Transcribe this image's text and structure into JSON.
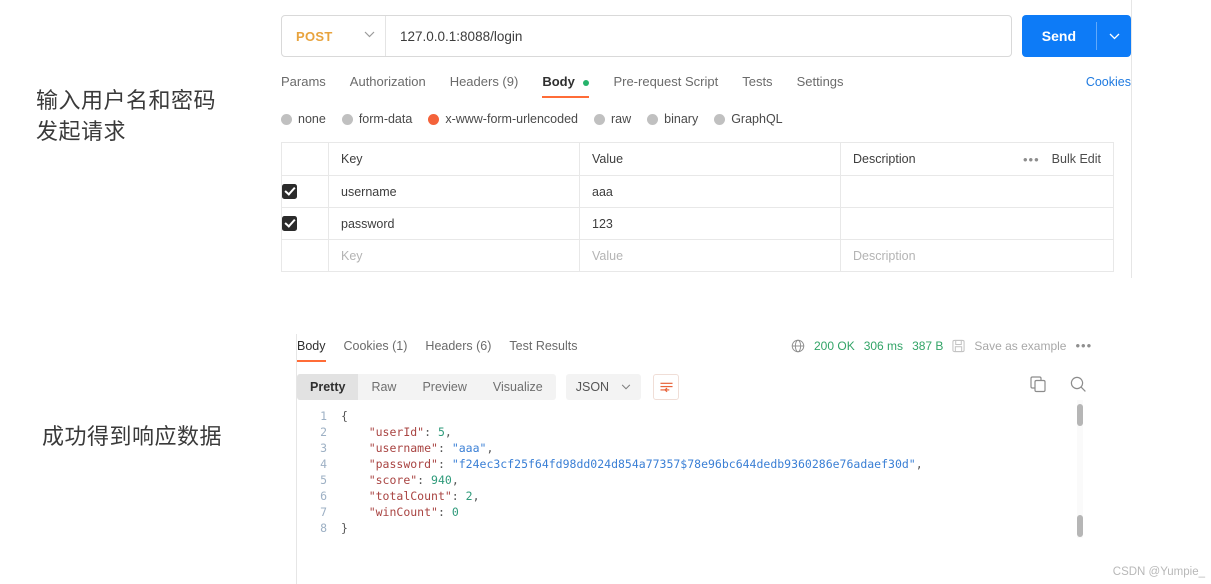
{
  "annotations": {
    "request_note": "输入用户名和密码\n发起请求",
    "response_note": "成功得到响应数据"
  },
  "request": {
    "method": "POST",
    "method_caret": "chevron-down",
    "url": "127.0.0.1:8088/login",
    "send_label": "Send",
    "send_caret": "chevron-down",
    "cookies_label": "Cookies",
    "tabs": [
      {
        "label": "Params",
        "active": false,
        "dot": false
      },
      {
        "label": "Authorization",
        "active": false,
        "dot": false
      },
      {
        "label": "Headers (9)",
        "active": false,
        "dot": false
      },
      {
        "label": "Body",
        "active": true,
        "dot": true
      },
      {
        "label": "Pre-request Script",
        "active": false,
        "dot": false
      },
      {
        "label": "Tests",
        "active": false,
        "dot": false
      },
      {
        "label": "Settings",
        "active": false,
        "dot": false
      }
    ],
    "body_types": [
      {
        "label": "none",
        "selected": false
      },
      {
        "label": "form-data",
        "selected": false
      },
      {
        "label": "x-www-form-urlencoded",
        "selected": true
      },
      {
        "label": "raw",
        "selected": false
      },
      {
        "label": "binary",
        "selected": false
      },
      {
        "label": "GraphQL",
        "selected": false
      }
    ],
    "table": {
      "headers": {
        "key": "Key",
        "value": "Value",
        "description": "Description",
        "bulk_edit": "Bulk Edit"
      },
      "rows": [
        {
          "checked": true,
          "key": "username",
          "value": "aaa",
          "description": "",
          "placeholder": false
        },
        {
          "checked": true,
          "key": "password",
          "value": "123",
          "description": "",
          "placeholder": false
        },
        {
          "checked": false,
          "key": "Key",
          "value": "Value",
          "description": "Description",
          "placeholder": true
        }
      ]
    }
  },
  "response": {
    "tabs": [
      {
        "label": "Body",
        "active": true
      },
      {
        "label": "Cookies (1)",
        "active": false
      },
      {
        "label": "Headers (6)",
        "active": false
      },
      {
        "label": "Test Results",
        "active": false
      }
    ],
    "status": "200 OK",
    "time": "306 ms",
    "size": "387 B",
    "save_as_example": "Save as example",
    "more_label": "•••",
    "formats": [
      {
        "label": "Pretty",
        "active": true
      },
      {
        "label": "Raw",
        "active": false
      },
      {
        "label": "Preview",
        "active": false
      },
      {
        "label": "Visualize",
        "active": false
      }
    ],
    "language": "JSON",
    "language_caret": "chevron-down",
    "line_numbers": [
      "1",
      "2",
      "3",
      "4",
      "5",
      "6",
      "7",
      "8"
    ],
    "body_json": {
      "userId": 5,
      "username": "aaa",
      "password": "f24ec3cf25f64fd98dd024d854a77357$78e96bc644dedb9360286e76adaef30d",
      "score": 940,
      "totalCount": 2,
      "winCount": 0
    },
    "code_lines": [
      "{",
      "    \"userId\": 5,",
      "    \"username\": \"aaa\",",
      "    \"password\": \"f24ec3cf25f64fd98dd024d854a77357$78e96bc644dedb9360286e76adaef30d\",",
      "    \"score\": 940,",
      "    \"totalCount\": 2,",
      "    \"winCount\": 0",
      "}"
    ]
  },
  "watermark": "CSDN @Yumpie_",
  "colors": {
    "accent_orange": "#ff6c37",
    "send_blue": "#0d7bf7",
    "link_blue": "#1f7ae0",
    "method_orange": "#e8a33d",
    "status_green": "#32a467",
    "body_dot_green": "#26b36b"
  }
}
